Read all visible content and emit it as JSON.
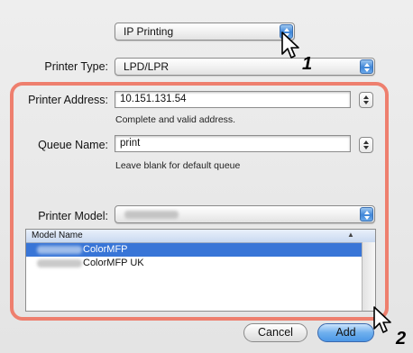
{
  "protocol_popup": {
    "value": "IP Printing"
  },
  "printer_type": {
    "label": "Printer Type:",
    "value": "LPD/LPR"
  },
  "printer_address": {
    "label": "Printer Address:",
    "value": "10.151.131.54",
    "hint": "Complete and valid address."
  },
  "queue_name": {
    "label": "Queue Name:",
    "value": "print",
    "hint": "Leave blank for default queue"
  },
  "printer_model": {
    "label": "Printer Model:"
  },
  "model_list": {
    "column_header": "Model Name",
    "rows": [
      {
        "name": "ColorMFP",
        "selected": true
      },
      {
        "name": "ColorMFP UK",
        "selected": false
      }
    ]
  },
  "buttons": {
    "cancel": "Cancel",
    "add": "Add"
  },
  "step_markers": {
    "first": "1",
    "second": "2"
  },
  "colors": {
    "highlight": "#ee7f6e",
    "selection": "#3875d7",
    "accent": "#4c97e6"
  }
}
